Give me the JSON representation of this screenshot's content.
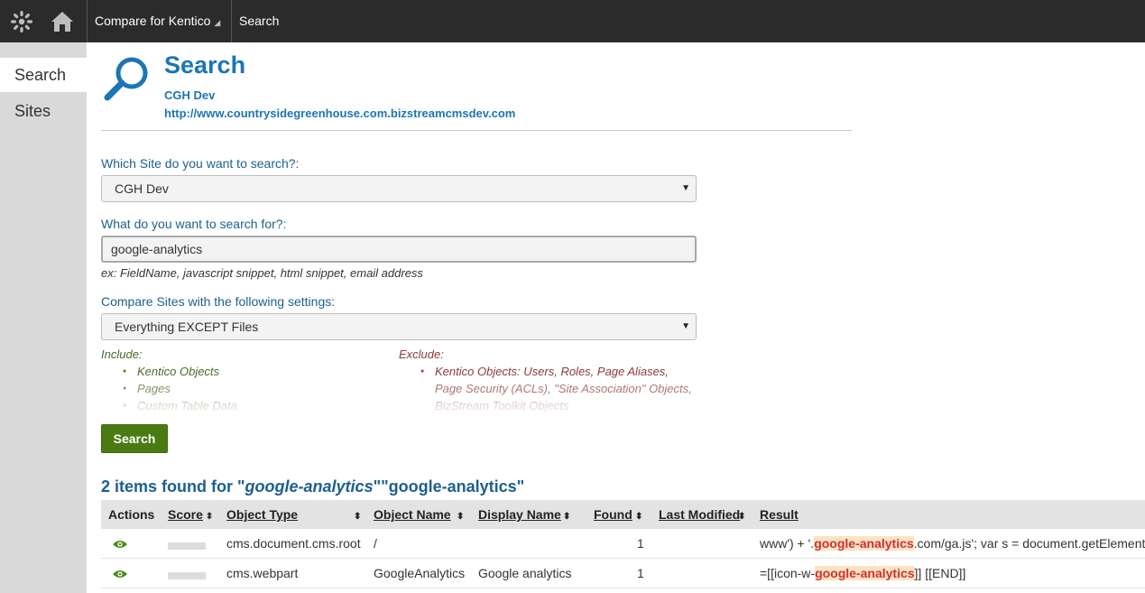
{
  "topbar": {
    "logo_icon": "kentico-logo-icon",
    "home_icon": "home-icon",
    "app_name": "Compare for Kentico",
    "app_menu_indicator": "◢",
    "page_name": "Search"
  },
  "sidebar": {
    "items": [
      {
        "label": "Search",
        "active": true
      },
      {
        "label": "Sites",
        "active": false
      }
    ]
  },
  "header": {
    "icon": "magnifier-icon",
    "title": "Search",
    "site_name": "CGH Dev",
    "site_url": "http://www.countrysidegreenhouse.com.bizstreamcmsdev.com"
  },
  "form": {
    "site_label": "Which Site do you want to search?:",
    "site_value": "CGH Dev",
    "query_label": "What do you want to search for?:",
    "query_value": "google-analytics",
    "query_hint": "ex: FieldName, javascript snippet, html snippet, email address",
    "settings_label": "Compare Sites with the following settings:",
    "settings_value": "Everything EXCEPT Files",
    "include_heading": "Include:",
    "include_items": [
      "Kentico Objects",
      "Pages",
      "Custom Table Data"
    ],
    "exclude_heading": "Exclude:",
    "exclude_items": [
      "Kentico Objects: Users, Roles, Page Aliases,",
      "Page Security (ACLs), \"Site Association\" Objects,",
      "BizStream Toolkit Objects"
    ],
    "search_button": "Search"
  },
  "results": {
    "prefix": "2 items found for \"",
    "term_italic": "google-analytics",
    "suffix": "\"\"google-analytics\"",
    "columns": [
      {
        "label": "Actions",
        "sortable": false
      },
      {
        "label": "Score",
        "sortable": true
      },
      {
        "label": "Object Type",
        "sortable": true
      },
      {
        "label": "Object Name",
        "sortable": true
      },
      {
        "label": "Display Name",
        "sortable": true
      },
      {
        "label": "Found",
        "sortable": true
      },
      {
        "label": "Last Modified",
        "sortable": true
      },
      {
        "label": "Result",
        "sortable": false
      }
    ],
    "sort_glyph": "▲▼",
    "rows": [
      {
        "action_icon": "eye-icon",
        "object_type": "cms.document.cms.root",
        "object_name": "/",
        "display_name": "",
        "found": "1",
        "last_modified": "",
        "result_before": "www') + '.",
        "result_match": "google-analytics",
        "result_after": ".com/ga.js'; var s = document.getElements"
      },
      {
        "action_icon": "eye-icon",
        "object_type": "cms.webpart",
        "object_name": "GoogleAnalytics",
        "display_name": "Google analytics",
        "found": "1",
        "last_modified": "",
        "result_before": "=[[icon-w-",
        "result_match": "google-analytics",
        "result_after": "]] [[END]]"
      }
    ]
  },
  "colors": {
    "topbar": "#2b2b2b",
    "accent_blue": "#1c75b4",
    "button_green": "#4a7b12",
    "highlight_bg": "#fbe3c4",
    "highlight_text": "#d0312d"
  }
}
